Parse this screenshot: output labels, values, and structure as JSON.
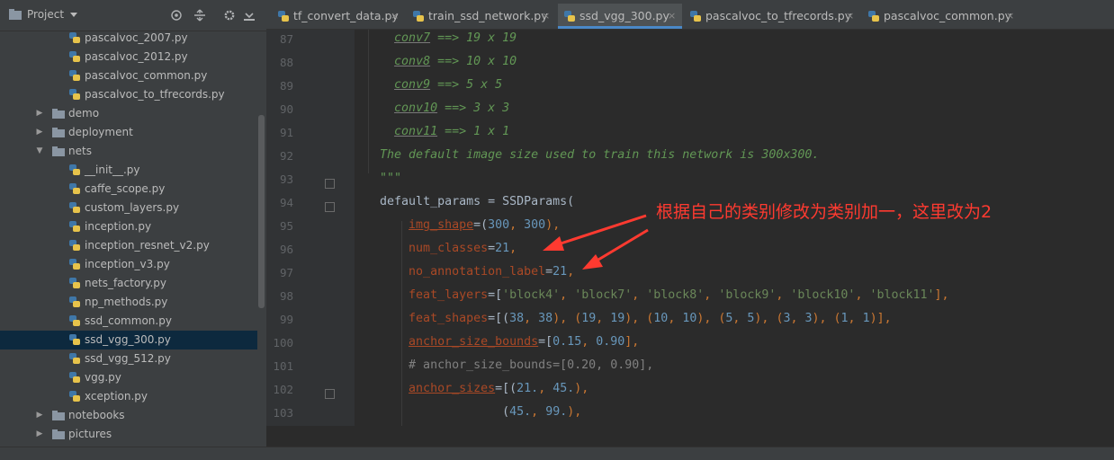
{
  "project_panel": {
    "title": "Project",
    "tree": [
      {
        "label": "pascalvoc_2007.py",
        "type": "file",
        "depth": 2
      },
      {
        "label": "pascalvoc_2012.py",
        "type": "file",
        "depth": 2
      },
      {
        "label": "pascalvoc_common.py",
        "type": "file",
        "depth": 2
      },
      {
        "label": "pascalvoc_to_tfrecords.py",
        "type": "file",
        "depth": 2
      },
      {
        "label": "demo",
        "type": "folder",
        "depth": 1,
        "expanded": false
      },
      {
        "label": "deployment",
        "type": "folder",
        "depth": 1,
        "expanded": false
      },
      {
        "label": "nets",
        "type": "folder",
        "depth": 1,
        "expanded": true
      },
      {
        "label": "__init__.py",
        "type": "file",
        "depth": 2
      },
      {
        "label": "caffe_scope.py",
        "type": "file",
        "depth": 2
      },
      {
        "label": "custom_layers.py",
        "type": "file",
        "depth": 2
      },
      {
        "label": "inception.py",
        "type": "file",
        "depth": 2
      },
      {
        "label": "inception_resnet_v2.py",
        "type": "file",
        "depth": 2
      },
      {
        "label": "inception_v3.py",
        "type": "file",
        "depth": 2
      },
      {
        "label": "nets_factory.py",
        "type": "file",
        "depth": 2
      },
      {
        "label": "np_methods.py",
        "type": "file",
        "depth": 2
      },
      {
        "label": "ssd_common.py",
        "type": "file",
        "depth": 2
      },
      {
        "label": "ssd_vgg_300.py",
        "type": "file",
        "depth": 2,
        "selected": true
      },
      {
        "label": "ssd_vgg_512.py",
        "type": "file",
        "depth": 2
      },
      {
        "label": "vgg.py",
        "type": "file",
        "depth": 2
      },
      {
        "label": "xception.py",
        "type": "file",
        "depth": 2
      },
      {
        "label": "notebooks",
        "type": "folder",
        "depth": 1,
        "expanded": false
      },
      {
        "label": "pictures",
        "type": "folder",
        "depth": 1,
        "expanded": false
      }
    ]
  },
  "tabs": [
    {
      "label": "tf_convert_data.py",
      "active": false
    },
    {
      "label": "train_ssd_network.py",
      "active": false
    },
    {
      "label": "ssd_vgg_300.py",
      "active": true
    },
    {
      "label": "pascalvoc_to_tfrecords.py",
      "active": false
    },
    {
      "label": "pascalvoc_common.py",
      "active": false
    }
  ],
  "tab_close_glyph": "×",
  "editor": {
    "line_numbers": [
      "87",
      "88",
      "89",
      "90",
      "91",
      "92",
      "93",
      "94",
      "95",
      "96",
      "97",
      "98",
      "99",
      "100",
      "101",
      "102",
      "103"
    ],
    "lines": [
      {
        "indent": "      ",
        "tokens": [
          {
            "t": "conv7",
            "c": "docu"
          },
          {
            "t": " ==> 19 x 19",
            "c": "doc"
          }
        ]
      },
      {
        "indent": "      ",
        "tokens": [
          {
            "t": "conv8",
            "c": "docu"
          },
          {
            "t": " ==> 10 x 10",
            "c": "doc"
          }
        ]
      },
      {
        "indent": "      ",
        "tokens": [
          {
            "t": "conv9",
            "c": "docu"
          },
          {
            "t": " ==> 5 x 5",
            "c": "doc"
          }
        ]
      },
      {
        "indent": "      ",
        "tokens": [
          {
            "t": "conv10",
            "c": "docu"
          },
          {
            "t": " ==> 3 x 3",
            "c": "doc"
          }
        ]
      },
      {
        "indent": "      ",
        "tokens": [
          {
            "t": "conv11",
            "c": "docu"
          },
          {
            "t": " ==> 1 x 1",
            "c": "doc"
          }
        ]
      },
      {
        "indent": "    ",
        "tokens": [
          {
            "t": "The default image size used to train this network is 300x300.",
            "c": "doc"
          }
        ]
      },
      {
        "indent": "    ",
        "tokens": [
          {
            "t": "\"\"\"",
            "c": "doc"
          }
        ]
      },
      {
        "indent": "    ",
        "tokens": [
          {
            "t": "default_params = SSDParams(",
            "c": ""
          }
        ]
      },
      {
        "indent": "        ",
        "tokens": [
          {
            "t": "img_shape",
            "c": "paramu"
          },
          {
            "t": "=(",
            "c": ""
          },
          {
            "t": "300",
            "c": "num"
          },
          {
            "t": ", ",
            "c": "kw"
          },
          {
            "t": "300",
            "c": "num"
          },
          {
            "t": "),",
            "c": "kw"
          }
        ]
      },
      {
        "indent": "        ",
        "tokens": [
          {
            "t": "num_classes",
            "c": "param"
          },
          {
            "t": "=",
            "c": ""
          },
          {
            "t": "21",
            "c": "num"
          },
          {
            "t": ",",
            "c": "kw"
          }
        ]
      },
      {
        "indent": "        ",
        "tokens": [
          {
            "t": "no_annotation_label",
            "c": "param"
          },
          {
            "t": "=",
            "c": ""
          },
          {
            "t": "21",
            "c": "num"
          },
          {
            "t": ",",
            "c": "kw"
          }
        ]
      },
      {
        "indent": "        ",
        "tokens": [
          {
            "t": "feat_layers",
            "c": "param"
          },
          {
            "t": "=[",
            "c": ""
          },
          {
            "t": "'block4'",
            "c": "str"
          },
          {
            "t": ", ",
            "c": "kw"
          },
          {
            "t": "'block7'",
            "c": "str"
          },
          {
            "t": ", ",
            "c": "kw"
          },
          {
            "t": "'block8'",
            "c": "str"
          },
          {
            "t": ", ",
            "c": "kw"
          },
          {
            "t": "'block9'",
            "c": "str"
          },
          {
            "t": ", ",
            "c": "kw"
          },
          {
            "t": "'block10'",
            "c": "str"
          },
          {
            "t": ", ",
            "c": "kw"
          },
          {
            "t": "'block11'",
            "c": "str"
          },
          {
            "t": "],",
            "c": "kw"
          }
        ]
      },
      {
        "indent": "        ",
        "tokens": [
          {
            "t": "feat_shapes",
            "c": "param"
          },
          {
            "t": "=[(",
            "c": ""
          },
          {
            "t": "38",
            "c": "num"
          },
          {
            "t": ", ",
            "c": "kw"
          },
          {
            "t": "38",
            "c": "num"
          },
          {
            "t": "), (",
            "c": "kw"
          },
          {
            "t": "19",
            "c": "num"
          },
          {
            "t": ", ",
            "c": "kw"
          },
          {
            "t": "19",
            "c": "num"
          },
          {
            "t": "), (",
            "c": "kw"
          },
          {
            "t": "10",
            "c": "num"
          },
          {
            "t": ", ",
            "c": "kw"
          },
          {
            "t": "10",
            "c": "num"
          },
          {
            "t": "), (",
            "c": "kw"
          },
          {
            "t": "5",
            "c": "num"
          },
          {
            "t": ", ",
            "c": "kw"
          },
          {
            "t": "5",
            "c": "num"
          },
          {
            "t": "), (",
            "c": "kw"
          },
          {
            "t": "3",
            "c": "num"
          },
          {
            "t": ", ",
            "c": "kw"
          },
          {
            "t": "3",
            "c": "num"
          },
          {
            "t": "), (",
            "c": "kw"
          },
          {
            "t": "1",
            "c": "num"
          },
          {
            "t": ", ",
            "c": "kw"
          },
          {
            "t": "1",
            "c": "num"
          },
          {
            "t": ")],",
            "c": "kw"
          }
        ]
      },
      {
        "indent": "        ",
        "tokens": [
          {
            "t": "anchor_size_bounds",
            "c": "paramu"
          },
          {
            "t": "=[",
            "c": ""
          },
          {
            "t": "0.15",
            "c": "num"
          },
          {
            "t": ", ",
            "c": "kw"
          },
          {
            "t": "0.90",
            "c": "num"
          },
          {
            "t": "],",
            "c": "kw"
          }
        ]
      },
      {
        "indent": "        ",
        "tokens": [
          {
            "t": "# anchor_size_bounds=[0.20, 0.90],",
            "c": "com"
          }
        ]
      },
      {
        "indent": "        ",
        "tokens": [
          {
            "t": "anchor_sizes",
            "c": "paramu"
          },
          {
            "t": "=[(",
            "c": ""
          },
          {
            "t": "21.",
            "c": "num"
          },
          {
            "t": ", ",
            "c": "kw"
          },
          {
            "t": "45.",
            "c": "num"
          },
          {
            "t": "),",
            "c": "kw"
          }
        ]
      },
      {
        "indent": "                     ",
        "tokens": [
          {
            "t": "(",
            "c": ""
          },
          {
            "t": "45.",
            "c": "num"
          },
          {
            "t": ", ",
            "c": "kw"
          },
          {
            "t": "99.",
            "c": "num"
          },
          {
            "t": "),",
            "c": "kw"
          }
        ]
      }
    ]
  },
  "annotation": {
    "text": "根据自己的类别修改为类别加一，这里改为2",
    "color": "#ff3a30"
  },
  "colors": {
    "selection": "#0d293e",
    "accent": "#4a88c7"
  }
}
